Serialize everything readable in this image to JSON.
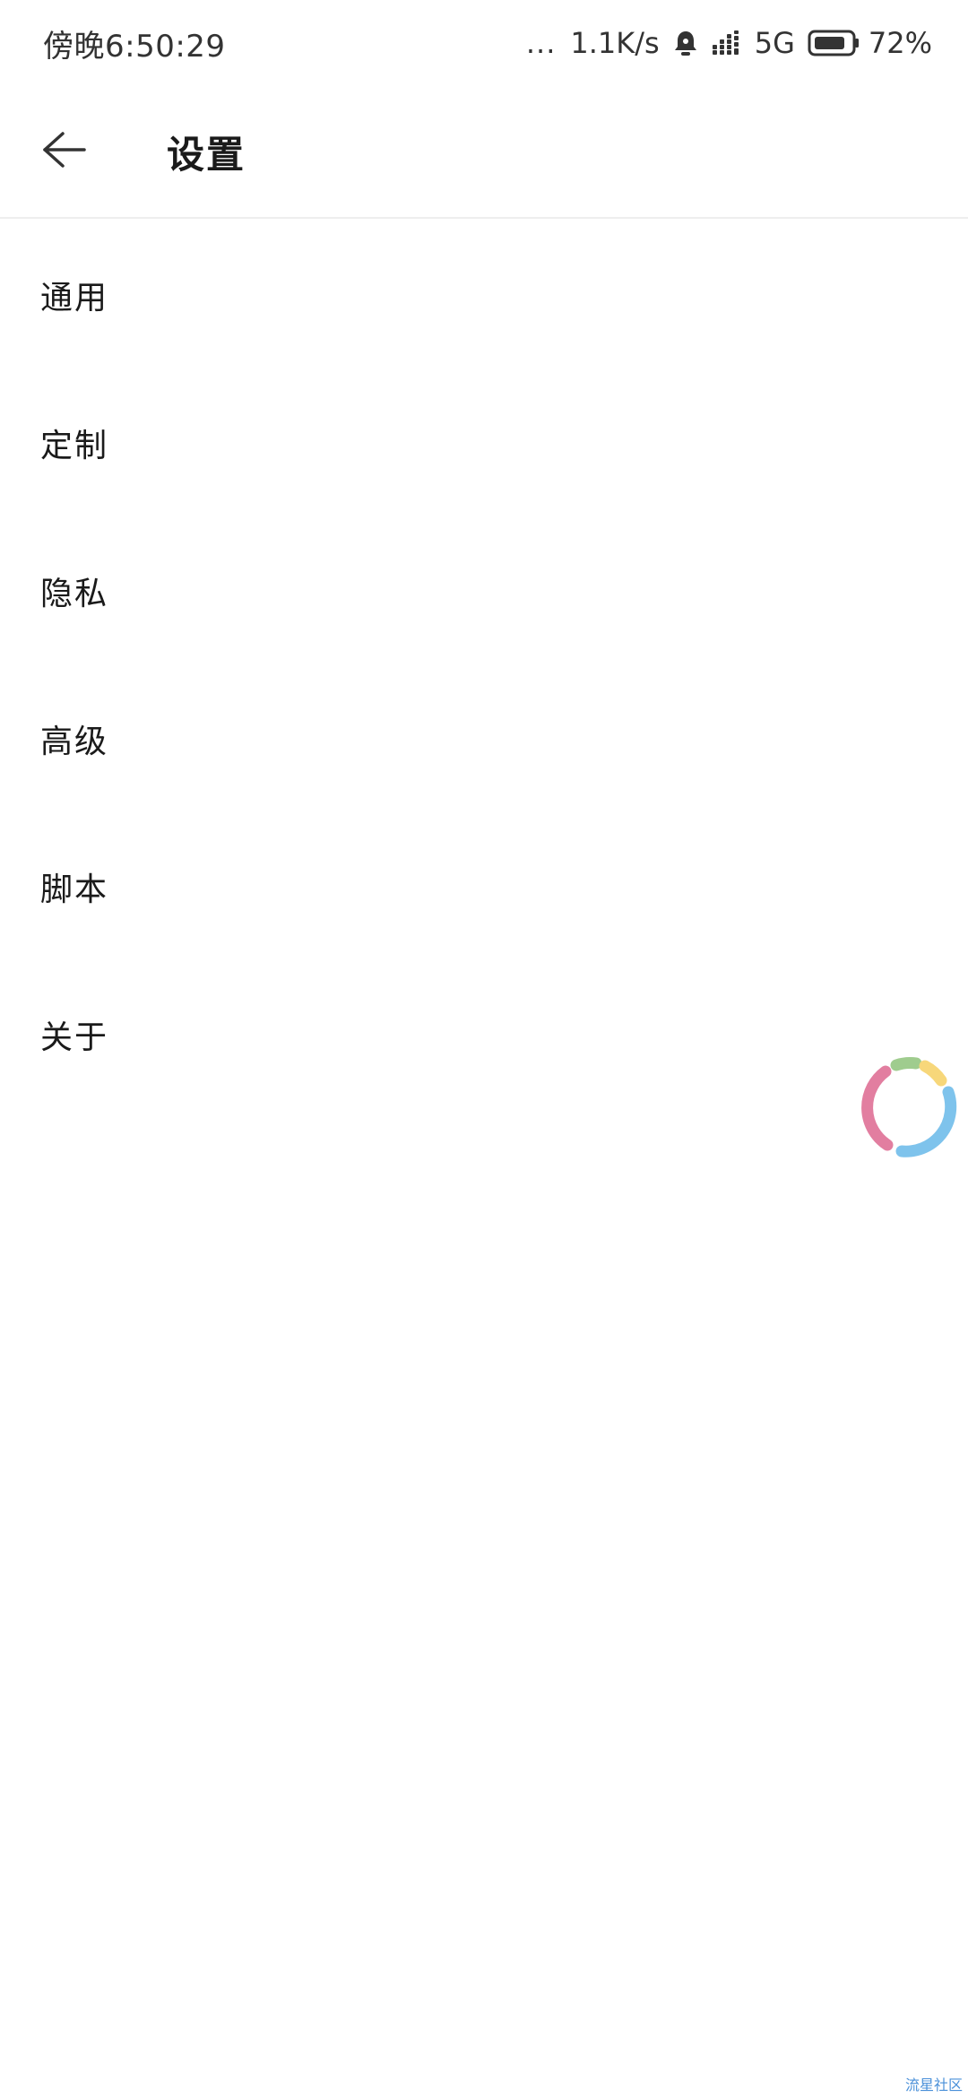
{
  "status_bar": {
    "time": "傍晚6:50:29",
    "dots": "...",
    "network_speed": "1.1K/s",
    "network_type": "5G",
    "battery_percent": "72%",
    "icons": [
      "alarm-icon",
      "signal-icon",
      "battery-icon"
    ]
  },
  "header": {
    "title": "设置",
    "back_icon": "arrow-left-icon"
  },
  "settings": {
    "items": [
      {
        "label": "通用"
      },
      {
        "label": "定制"
      },
      {
        "label": "隐私"
      },
      {
        "label": "高级"
      },
      {
        "label": "脚本"
      },
      {
        "label": "关于"
      }
    ]
  },
  "floating_loader": {
    "colors": [
      "#e27ea0",
      "#9fcc8e",
      "#f7d77a",
      "#7ec3ec"
    ]
  },
  "watermark": "流星社区"
}
